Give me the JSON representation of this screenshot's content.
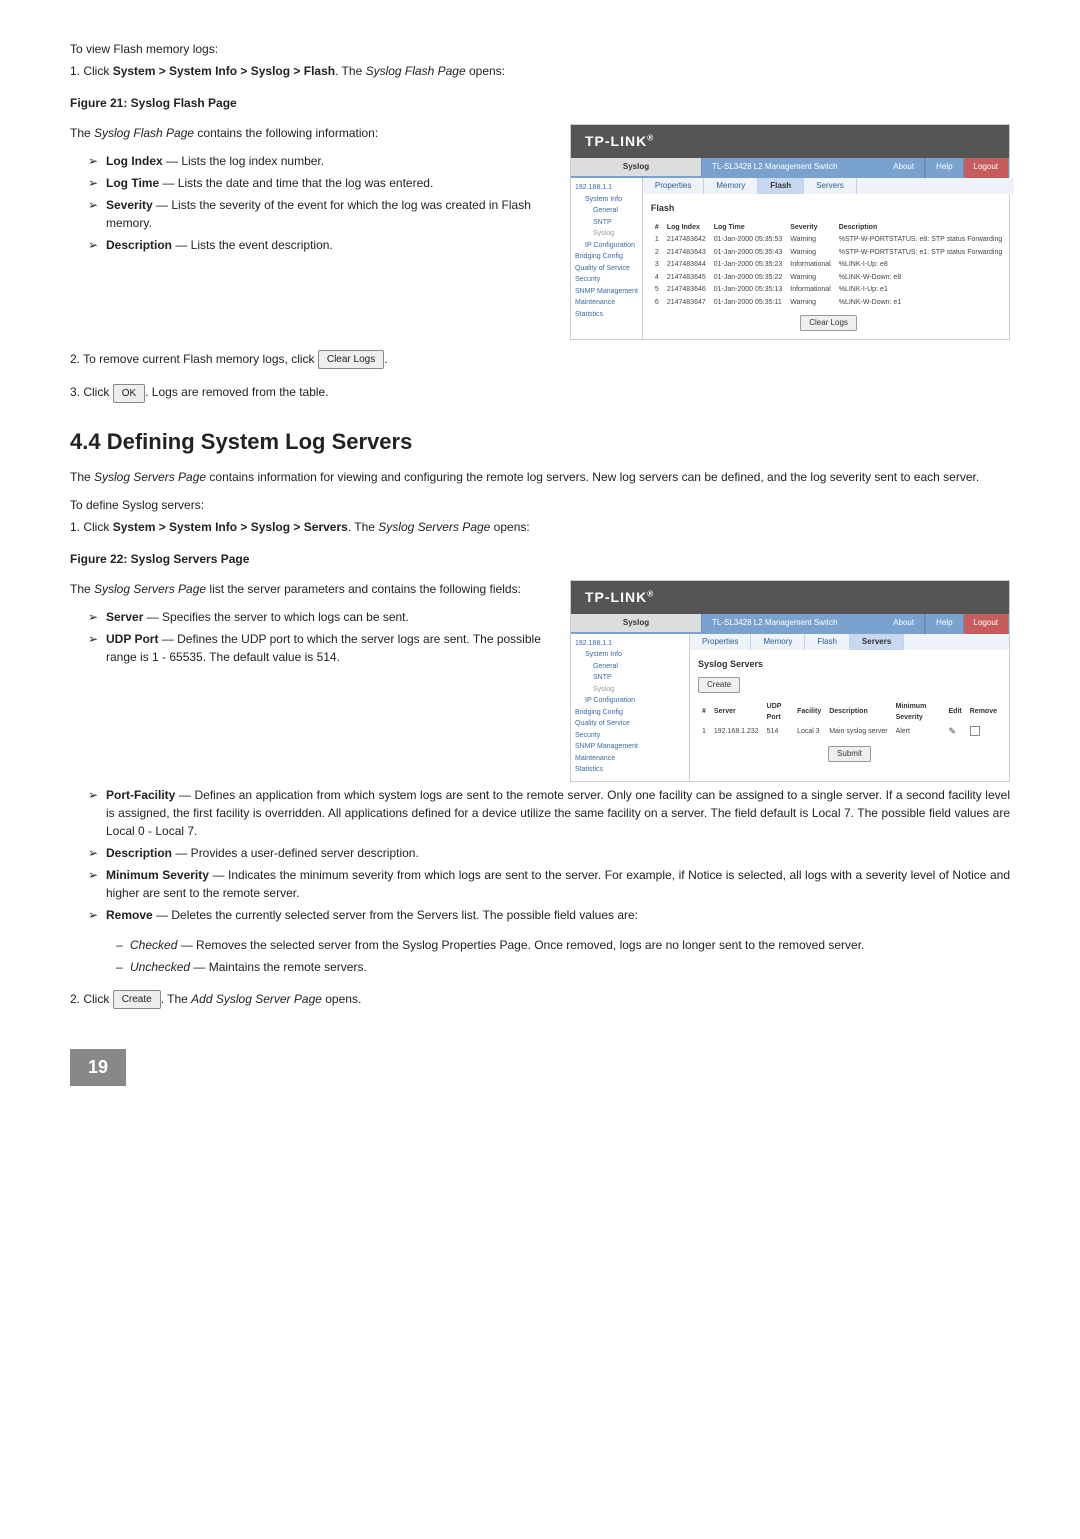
{
  "flash_section": {
    "intro": "To view Flash memory logs:",
    "step1_prefix": "1.  Click ",
    "step1_bold": "System > System Info > Syslog > Flash",
    "step1_mid": ". The ",
    "step1_italic": "Syslog Flash Page",
    "step1_end": " opens:",
    "fig_title": "Figure 21: Syslog Flash Page",
    "left_intro_1": "The ",
    "left_intro_italic": "Syslog Flash Page",
    "left_intro_2": " contains the following information:",
    "bullets": {
      "b1_b": "Log Index",
      "b1_t": " — Lists the log index number.",
      "b2_b": "Log Time",
      "b2_t": " — Lists the date and time that the log was entered.",
      "b3_b": "Severity",
      "b3_t": " — Lists the severity of the event for which the log was created in Flash memory.",
      "b4_b": "Description",
      "b4_t": " — Lists the event description."
    },
    "step2_prefix": "2.  To remove current Flash memory logs, click ",
    "step2_btn": "Clear Logs",
    "step2_end": ".",
    "step3_prefix": "3.  Click ",
    "step3_btn": "OK",
    "step3_end": ". Logs are removed from the table."
  },
  "servers_section": {
    "heading": "4.4   Defining System Log Servers",
    "para1_1": "The ",
    "para1_italic": "Syslog Servers Page",
    "para1_2": " contains information for viewing and configuring the remote log servers. New log servers can be defined, and the log severity sent to each server.",
    "subintro": "To define Syslog servers:",
    "step1_prefix": "1.  Click ",
    "step1_bold": "System > System Info > Syslog > Servers",
    "step1_mid": ". The ",
    "step1_italic": "Syslog Servers Page",
    "step1_end": " opens:",
    "fig_title": "Figure 22: Syslog Servers Page",
    "left_intro_1": "The ",
    "left_intro_italic": "Syslog Servers Page",
    "left_intro_2": " list the server parameters and contains the following fields:",
    "bullets_left": {
      "b1_b": "Server",
      "b1_t": " — Specifies the server to which logs can be sent.",
      "b2_b": "UDP Port",
      "b2_t": " — Defines the UDP port to which the server logs are sent. The possible range is 1 - 65535. The default value is 514."
    },
    "bullets_full": {
      "b3_b": "Port-Facility",
      "b3_t": " — Defines an application from which system logs are sent to the remote server. Only one facility can be assigned to a single server. If a second facility level is assigned, the first facility is overridden. All applications defined for a device utilize the same facility on a server. The field default is Local 7. The possible field values are Local 0 - Local 7.",
      "b4_b": "Description",
      "b4_t": " — Provides a user-defined server description.",
      "b5_b": "Minimum Severity",
      "b5_t": " — Indicates the minimum severity from which logs are sent to the server. For example, if Notice is selected, all logs with a severity level of Notice and higher are sent to the remote server.",
      "b6_b": "Remove",
      "b6_t": " — Deletes the currently selected server from the Servers list. The possible field values are:"
    },
    "sub": {
      "s1_i": "Checked",
      "s1_t": " — Removes the selected server from the Syslog Properties Page. Once removed, logs are no longer sent to the removed server.",
      "s2_i": "Unchecked",
      "s2_t": " — Maintains the remote servers."
    },
    "step2_prefix": "2.  Click ",
    "step2_btn": "Create",
    "step2_mid": ". The ",
    "step2_italic": "Add Syslog Server Page",
    "step2_end": " opens."
  },
  "shot_common": {
    "brand": "TP-LINK",
    "subtitle": "TL-SL3428 L2 Management Switch",
    "about": "About",
    "help": "Help",
    "logout": "Logout",
    "nav_title": "Syslog",
    "nav": {
      "root": "192.168.1.1",
      "sysinfo": "System Info",
      "general": "General",
      "sntp": "SNTP",
      "syslog": "Syslog",
      "ipconf": "IP Configuration",
      "bridging": "Bridging Config",
      "qos": "Quality of Service",
      "security": "Security",
      "snmp": "SNMP Management",
      "maint": "Maintenance",
      "stats": "Statistics"
    }
  },
  "flash_shot": {
    "tabs": {
      "prop": "Properties",
      "mem": "Memory",
      "flash": "Flash",
      "servers": "Servers"
    },
    "heading": "Flash",
    "cols": {
      "idx": "#",
      "log": "Log Index",
      "time": "Log Time",
      "sev": "Severity",
      "desc": "Description"
    },
    "rows": [
      {
        "n": "1",
        "idx": "2147483642",
        "time": "01-Jan-2000 05:35:53",
        "sev": "Warning",
        "desc": "%STP-W-PORTSTATUS: e8: STP status Forwarding"
      },
      {
        "n": "2",
        "idx": "2147483643",
        "time": "01-Jan-2000 05:35:43",
        "sev": "Warning",
        "desc": "%STP-W-PORTSTATUS: e1: STP status Forwarding"
      },
      {
        "n": "3",
        "idx": "2147483644",
        "time": "01-Jan-2000 05:35:23",
        "sev": "Informational",
        "desc": "%LINK-I-Up: e8"
      },
      {
        "n": "4",
        "idx": "2147483645",
        "time": "01-Jan-2000 05:35:22",
        "sev": "Warning",
        "desc": "%LINK-W-Down: e8"
      },
      {
        "n": "5",
        "idx": "2147483646",
        "time": "01-Jan-2000 05:35:13",
        "sev": "Informational",
        "desc": "%LINK-I-Up: e1"
      },
      {
        "n": "6",
        "idx": "2147483647",
        "time": "01-Jan-2000 05:35:11",
        "sev": "Warning",
        "desc": "%LINK-W-Down: e1"
      }
    ],
    "clear_btn": "Clear Logs"
  },
  "servers_shot": {
    "tabs": {
      "prop": "Properties",
      "mem": "Memory",
      "flash": "Flash",
      "servers": "Servers"
    },
    "heading": "Syslog Servers",
    "create_btn": "Create",
    "cols": {
      "idx": "#",
      "server": "Server",
      "udp": "UDP Port",
      "fac": "Facility",
      "desc": "Description",
      "min": "Minimum Severity",
      "edit": "Edit",
      "rem": "Remove"
    },
    "row": {
      "n": "1",
      "server": "192.168.1.232",
      "udp": "514",
      "fac": "Local 3",
      "desc": "Main syslog server",
      "min": "Alert"
    },
    "submit_btn": "Submit"
  },
  "page_number": "19"
}
